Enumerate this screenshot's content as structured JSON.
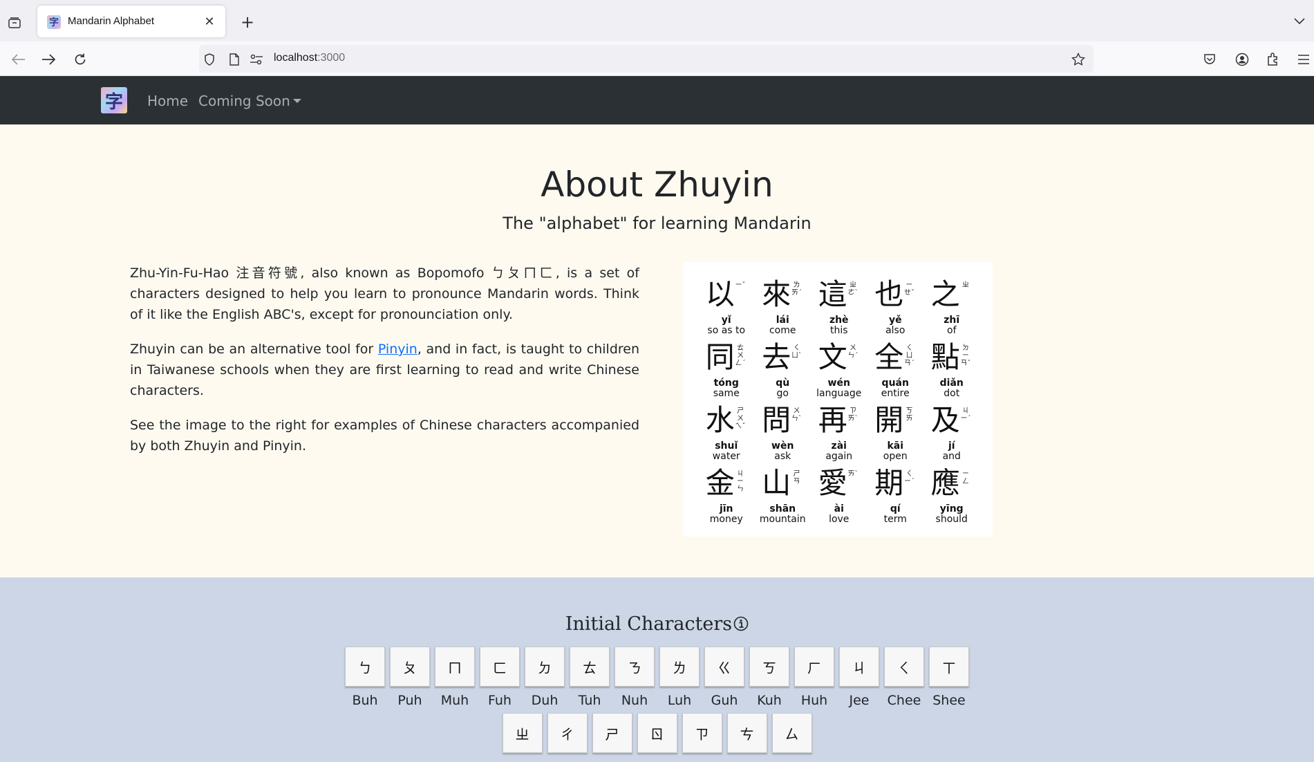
{
  "browser": {
    "tab_title": "Mandarin Alphabet",
    "url_host": "localhost",
    "url_port": ":3000"
  },
  "site": {
    "nav": {
      "logo_glyph": "字",
      "home": "Home",
      "coming_soon": "Coming Soon"
    }
  },
  "about": {
    "title": "About Zhuyin",
    "subtitle": "The \"alphabet\" for learning Mandarin",
    "p1": "Zhu-Yin-Fu-Hao 注音符號, also known as Bopomofo ㄅㄆㄇㄈ, is a set of characters designed to help you learn to pronounce Mandarin words. Think of it like the English ABC's, except for pronounciation only.",
    "p2_before": "Zhuyin can be an alternative tool for ",
    "p2_link": "Pinyin",
    "p2_after": ", and in fact, is taught to children in Taiwanese schools when they are first learning to read and write Chinese characters.",
    "p3": "See the image to the right for examples of Chinese characters accompanied by both Zhuyin and Pinyin."
  },
  "example_chars": [
    {
      "han": "以",
      "zhuyin": "ㄧˇ",
      "pinyin": "yǐ",
      "english": "so as to"
    },
    {
      "han": "來",
      "zhuyin": "ㄌㄞˊ",
      "pinyin": "lái",
      "english": "come"
    },
    {
      "han": "這",
      "zhuyin": "ㄓㄜˋ",
      "pinyin": "zhè",
      "english": "this"
    },
    {
      "han": "也",
      "zhuyin": "ㄧㄝˇ",
      "pinyin": "yě",
      "english": "also"
    },
    {
      "han": "之",
      "zhuyin": "ㄓ",
      "pinyin": "zhī",
      "english": "of"
    },
    {
      "han": "同",
      "zhuyin": "ㄊㄨㄥˊ",
      "pinyin": "tóng",
      "english": "same"
    },
    {
      "han": "去",
      "zhuyin": "ㄑㄩˋ",
      "pinyin": "qù",
      "english": "go"
    },
    {
      "han": "文",
      "zhuyin": "ㄨㄣˊ",
      "pinyin": "wén",
      "english": "language"
    },
    {
      "han": "全",
      "zhuyin": "ㄑㄩㄢˊ",
      "pinyin": "quán",
      "english": "entire"
    },
    {
      "han": "點",
      "zhuyin": "ㄉㄧㄢˇ",
      "pinyin": "diǎn",
      "english": "dot"
    },
    {
      "han": "水",
      "zhuyin": "ㄕㄨㄟˇ",
      "pinyin": "shuǐ",
      "english": "water"
    },
    {
      "han": "問",
      "zhuyin": "ㄨㄣˋ",
      "pinyin": "wèn",
      "english": "ask"
    },
    {
      "han": "再",
      "zhuyin": "ㄗㄞˋ",
      "pinyin": "zài",
      "english": "again"
    },
    {
      "han": "開",
      "zhuyin": "ㄎㄞ",
      "pinyin": "kāi",
      "english": "open"
    },
    {
      "han": "及",
      "zhuyin": "ㄐㄧˊ",
      "pinyin": "jí",
      "english": "and"
    },
    {
      "han": "金",
      "zhuyin": "ㄐㄧㄣ",
      "pinyin": "jīn",
      "english": "money"
    },
    {
      "han": "山",
      "zhuyin": "ㄕㄢ",
      "pinyin": "shān",
      "english": "mountain"
    },
    {
      "han": "愛",
      "zhuyin": "ㄞˋ",
      "pinyin": "ài",
      "english": "love"
    },
    {
      "han": "期",
      "zhuyin": "ㄑㄧˊ",
      "pinyin": "qí",
      "english": "term"
    },
    {
      "han": "應",
      "zhuyin": "ㄧㄥ",
      "pinyin": "yīng",
      "english": "should"
    }
  ],
  "initials": {
    "title": "Initial Characters",
    "info_icon": "info-circle-icon",
    "row1": [
      {
        "glyph": "ㄅ",
        "label": "Buh"
      },
      {
        "glyph": "ㄆ",
        "label": "Puh"
      },
      {
        "glyph": "ㄇ",
        "label": "Muh"
      },
      {
        "glyph": "ㄈ",
        "label": "Fuh"
      },
      {
        "glyph": "ㄉ",
        "label": "Duh"
      },
      {
        "glyph": "ㄊ",
        "label": "Tuh"
      },
      {
        "glyph": "ㄋ",
        "label": "Nuh"
      },
      {
        "glyph": "ㄌ",
        "label": "Luh"
      },
      {
        "glyph": "ㄍ",
        "label": "Guh"
      },
      {
        "glyph": "ㄎ",
        "label": "Kuh"
      },
      {
        "glyph": "ㄏ",
        "label": "Huh"
      },
      {
        "glyph": "ㄐ",
        "label": "Jee"
      },
      {
        "glyph": "ㄑ",
        "label": "Chee"
      },
      {
        "glyph": "ㄒ",
        "label": "Shee"
      }
    ],
    "row2": [
      {
        "glyph": "ㄓ"
      },
      {
        "glyph": "ㄔ"
      },
      {
        "glyph": "ㄕ"
      },
      {
        "glyph": "ㄖ"
      },
      {
        "glyph": "ㄗ"
      },
      {
        "glyph": "ㄘ"
      },
      {
        "glyph": "ㄙ"
      }
    ]
  }
}
